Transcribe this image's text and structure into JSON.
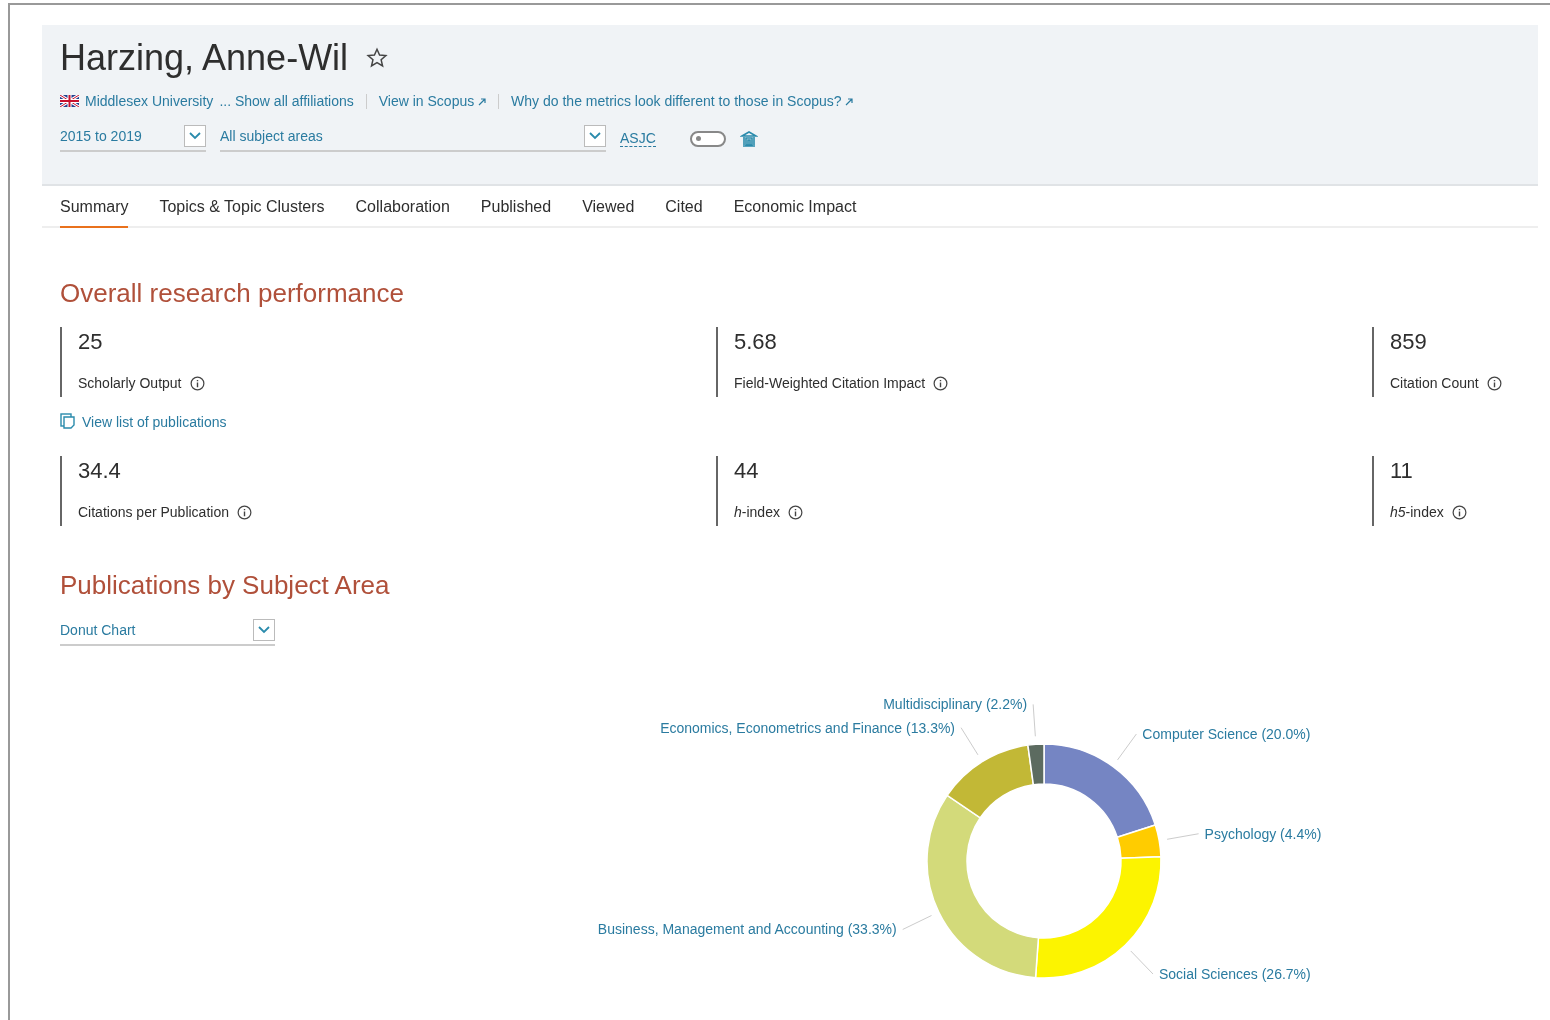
{
  "header": {
    "name": "Harzing, Anne-Wil",
    "starred": false,
    "affiliation": "Middlesex University",
    "show_all": "... Show all affiliations",
    "links": [
      "View in Scopus",
      "Why do the metrics look different to those in Scopus?"
    ],
    "period": "2015 to 2019",
    "subject": "All subject areas",
    "classification": "ASJC",
    "toggle_on": false
  },
  "tabs": [
    {
      "label": "Summary",
      "selected": true
    },
    {
      "label": "Topics & Topic Clusters",
      "selected": false
    },
    {
      "label": "Collaboration",
      "selected": false
    },
    {
      "label": "Published",
      "selected": false
    },
    {
      "label": "Viewed",
      "selected": false
    },
    {
      "label": "Cited",
      "selected": false
    },
    {
      "label": "Economic Impact",
      "selected": false
    }
  ],
  "performance": {
    "title": "Overall research performance",
    "metrics": [
      {
        "value": "25",
        "label": "Scholarly Output"
      },
      {
        "value": "5.68",
        "label": "Field-Weighted Citation Impact"
      },
      {
        "value": "859",
        "label": "Citation Count"
      },
      {
        "value": "34.4",
        "label": "Citations per Publication"
      },
      {
        "value": "44",
        "label": "*h*-index"
      },
      {
        "value": "11",
        "label": "*h5*-index"
      }
    ],
    "list_link": "View list of publications"
  },
  "subjects": {
    "title": "Publications by Subject Area",
    "view": "Donut Chart",
    "chart_data": {
      "type": "donut",
      "categories": [
        "Computer Science (20.0%)",
        "Psychology (4.4%)",
        "Social Sciences (26.7%)",
        "Business, Management and Accounting (33.3%)",
        "Economics, Econometrics and Finance (13.3%)",
        "Multidisciplinary (2.2%)"
      ],
      "values": [
        20.0,
        4.4,
        26.7,
        33.3,
        13.3,
        2.2
      ],
      "colors": [
        "#7585c3",
        "#ffcc00",
        "#fcf400",
        "#d3da7a",
        "#c2b836",
        "#5c6b60"
      ]
    }
  }
}
